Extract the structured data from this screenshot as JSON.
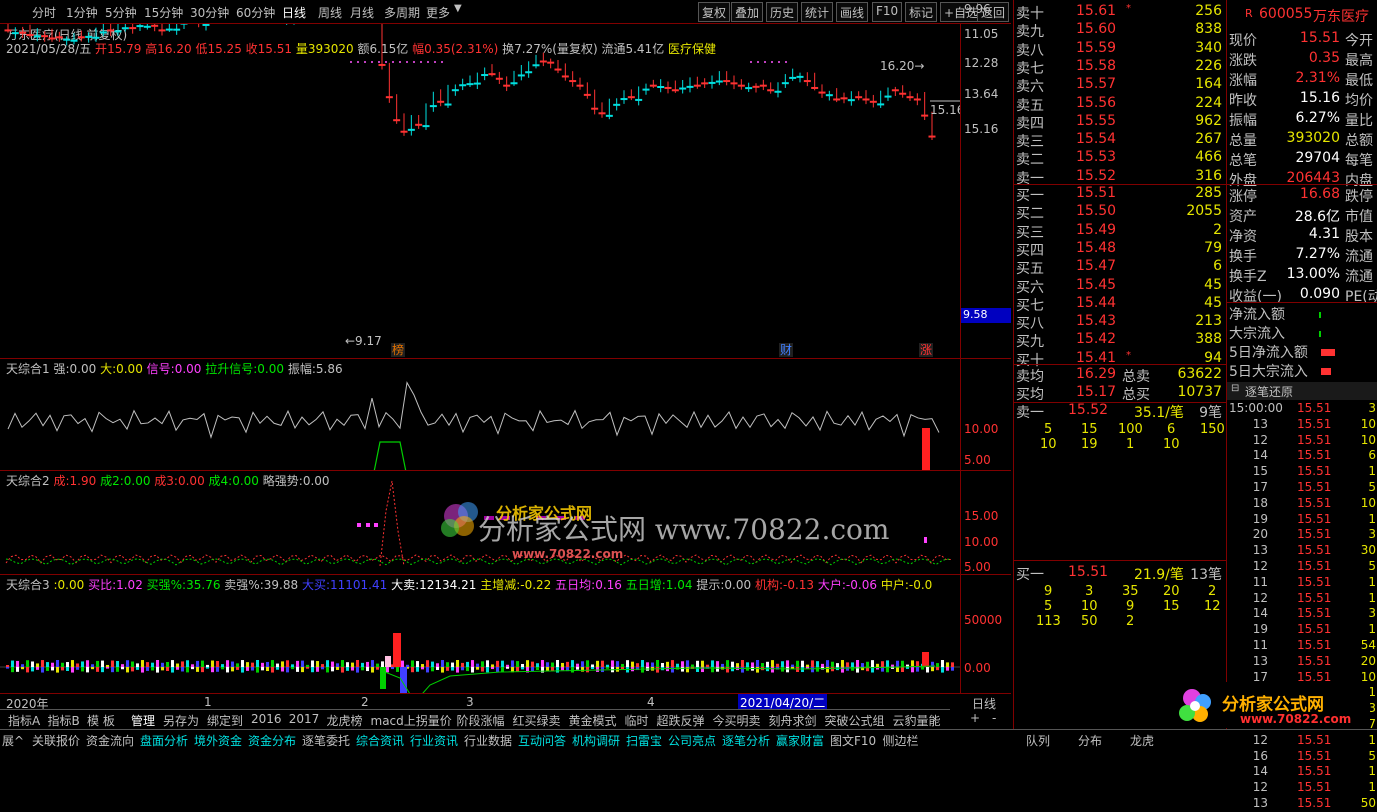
{
  "toolbar": {
    "periods": [
      "分时",
      "1分钟",
      "5分钟",
      "15分钟",
      "30分钟",
      "60分钟",
      "日线",
      "周线",
      "月线",
      "多周期",
      "更多"
    ],
    "active_period": "日线",
    "buttons": [
      "复权",
      "叠加",
      "历史",
      "统计",
      "画线",
      "F10",
      "标记",
      "+自选",
      "返回"
    ]
  },
  "stock": {
    "title": "万东医疗(日线 前复权)",
    "date": "2021/05/28/五",
    "open_label": "开",
    "open": "15.79",
    "high_label": "高",
    "high": "16.20",
    "low_label": "低",
    "low": "15.25",
    "close_label": "收",
    "close": "15.51",
    "vol_label": "量",
    "vol": "393020",
    "amt_label": "额",
    "amt": "6.15亿",
    "chg_label": "幅",
    "chg": "0.35(2.31%)",
    "turnover": "换7.27%(量复权)",
    "float": "流通5.41亿",
    "sector": "医疗保健"
  },
  "price_axis": [
    "15.16",
    "13.64",
    "12.28",
    "11.05",
    "9.96"
  ],
  "price_current": "9.58",
  "price_annotations": {
    "high": "16.20",
    "low": "9.17",
    "last": "15.16"
  },
  "markers": [
    "榜",
    "财",
    "涨"
  ],
  "ind1": {
    "name": "天综合1",
    "fields": [
      {
        "label": "强:",
        "value": "0.00",
        "color": "#c0c0c0"
      },
      {
        "label": "大:",
        "value": "0.00",
        "color": "#e6e600"
      },
      {
        "label": "信号:",
        "value": "0.00",
        "color": "#ff40ff"
      },
      {
        "label": "拉升信号:",
        "value": "0.00",
        "color": "#00e600"
      },
      {
        "label": "振幅:",
        "value": "5.86",
        "color": "#c0c0c0"
      }
    ],
    "axis": [
      "10.00",
      "5.00"
    ]
  },
  "ind2": {
    "name": "天综合2",
    "fields": [
      {
        "label": "成:",
        "value": "1.90",
        "color": "#ff3232"
      },
      {
        "label": "成2:",
        "value": "0.00",
        "color": "#00e600"
      },
      {
        "label": "成3:",
        "value": "0.00",
        "color": "#ff3232"
      },
      {
        "label": "成4:",
        "value": "0.00",
        "color": "#00e600"
      },
      {
        "label": "略强势:",
        "value": "0.00",
        "color": "#c0c0c0"
      }
    ],
    "axis": [
      "15.00",
      "10.00",
      "5.00"
    ],
    "watermark": "分析家公式网 www.70822.com",
    "watermark_small": "www.70822.com"
  },
  "ind3": {
    "name": "天综合3",
    "fields": [
      {
        "label": ":",
        "value": "0.00",
        "color": "#e6e600"
      },
      {
        "label": "买比:",
        "value": "1.02",
        "color": "#ff40ff"
      },
      {
        "label": "买强%:",
        "value": "35.76",
        "color": "#00e600"
      },
      {
        "label": "卖强%:",
        "value": "39.88",
        "color": "#c0c0c0"
      },
      {
        "label": "大买:",
        "value": "11101.41",
        "color": "#4040ff"
      },
      {
        "label": "大卖:",
        "value": "12134.21",
        "color": "#ffffff"
      },
      {
        "label": "主增减:",
        "value": "-0.22",
        "color": "#e6e600"
      },
      {
        "label": "五日均:",
        "value": "0.16",
        "color": "#ff40ff"
      },
      {
        "label": "五日增:",
        "value": "1.04",
        "color": "#00e600"
      },
      {
        "label": "提示:",
        "value": "0.00",
        "color": "#c0c0c0"
      },
      {
        "label": "机构:",
        "value": "-0.13",
        "color": "#ff3232"
      },
      {
        "label": "大户:",
        "value": "-0.06",
        "color": "#ff40ff"
      },
      {
        "label": "中户:",
        "value": "-0.0",
        "color": "#e6e600"
      }
    ],
    "axis": [
      "50000",
      "0.00"
    ]
  },
  "time_axis": {
    "year": "2020年",
    "m1": "1",
    "m2": "2",
    "m3": "3",
    "m4": "4",
    "cursor": "2021/04/20/二",
    "period": "日线"
  },
  "tabs1": [
    "指标A",
    "指标B",
    "模 板",
    "管理",
    "另存为",
    "绑定到",
    "2016",
    "2017",
    "龙虎榜",
    "macd上拐量价",
    "阶段涨幅",
    "红买绿卖",
    "黄金模式",
    "临时",
    "超跌反弹",
    "今买明卖",
    "刻舟求剑",
    "突破公式组",
    "云豹量能"
  ],
  "tabs1_active": "管理",
  "tabs2": [
    "展^",
    "关联报价",
    "资金流向",
    "盘面分析",
    "境外资金",
    "资金分布",
    "逐笔委托",
    "综合资讯",
    "行业资讯",
    "行业数据",
    "互动问答",
    "机构调研",
    "扫雷宝",
    "公司亮点",
    "逐笔分析",
    "赢家财富",
    "图文F10",
    "侧边栏"
  ],
  "tabs2_cyan": [
    "盘面分析",
    "境外资金",
    "资金分布",
    "综合资讯",
    "行业资讯",
    "互动问答",
    "机构调研",
    "扫雷宝",
    "公司亮点",
    "逐笔分析",
    "赢家财富"
  ],
  "right_tabs": [
    "队列",
    "分布",
    "龙虎"
  ],
  "orderbook": {
    "sells": [
      {
        "label": "卖十",
        "price": "15.61",
        "vol": "256",
        "flag": "*"
      },
      {
        "label": "卖九",
        "price": "15.60",
        "vol": "838",
        "flag": ""
      },
      {
        "label": "卖八",
        "price": "15.59",
        "vol": "340",
        "flag": ""
      },
      {
        "label": "卖七",
        "price": "15.58",
        "vol": "226",
        "flag": ""
      },
      {
        "label": "卖六",
        "price": "15.57",
        "vol": "164",
        "flag": ""
      },
      {
        "label": "卖五",
        "price": "15.56",
        "vol": "224",
        "flag": ""
      },
      {
        "label": "卖四",
        "price": "15.55",
        "vol": "962",
        "flag": ""
      },
      {
        "label": "卖三",
        "price": "15.54",
        "vol": "267",
        "flag": ""
      },
      {
        "label": "卖二",
        "price": "15.53",
        "vol": "466",
        "flag": ""
      },
      {
        "label": "卖一",
        "price": "15.52",
        "vol": "316",
        "flag": ""
      }
    ],
    "buys": [
      {
        "label": "买一",
        "price": "15.51",
        "vol": "285",
        "flag": ""
      },
      {
        "label": "买二",
        "price": "15.50",
        "vol": "2055",
        "flag": ""
      },
      {
        "label": "买三",
        "price": "15.49",
        "vol": "2",
        "flag": ""
      },
      {
        "label": "买四",
        "price": "15.48",
        "vol": "79",
        "flag": ""
      },
      {
        "label": "买五",
        "price": "15.47",
        "vol": "6",
        "flag": ""
      },
      {
        "label": "买六",
        "price": "15.45",
        "vol": "45",
        "flag": ""
      },
      {
        "label": "买七",
        "price": "15.44",
        "vol": "45",
        "flag": ""
      },
      {
        "label": "买八",
        "price": "15.43",
        "vol": "213",
        "flag": ""
      },
      {
        "label": "买九",
        "price": "15.42",
        "vol": "388",
        "flag": ""
      },
      {
        "label": "买十",
        "price": "15.41",
        "vol": "94",
        "flag": "*"
      }
    ],
    "avg_sell_label": "卖均",
    "avg_sell": "16.29",
    "total_sell_label": "总卖",
    "total_sell": "63622",
    "avg_buy_label": "买均",
    "avg_buy": "15.17",
    "total_buy_label": "总买",
    "total_buy": "10737",
    "sell1_queue": {
      "label": "卖一",
      "price": "15.52",
      "avg": "35.1/笔",
      "count": "9笔",
      "rows": [
        [
          "5",
          "15",
          "100",
          "6",
          "150"
        ],
        [
          "10",
          "19",
          "1",
          "10",
          ""
        ]
      ]
    },
    "buy1_queue": {
      "label": "买一",
      "price": "15.51",
      "avg": "21.9/笔",
      "count": "13笔",
      "rows": [
        [
          "9",
          "3",
          "35",
          "20",
          "2"
        ],
        [
          "5",
          "10",
          "9",
          "15",
          "12"
        ],
        [
          "113",
          "50",
          "2",
          "",
          ""
        ]
      ]
    }
  },
  "quote": {
    "code": "600055",
    "name": "万东医疗",
    "r": "R",
    "rows": [
      {
        "label": "现价",
        "value": "15.51",
        "extra": "今开",
        "color": "#ff3232"
      },
      {
        "label": "涨跌",
        "value": "0.35",
        "extra": "最高",
        "color": "#ff3232"
      },
      {
        "label": "涨幅",
        "value": "2.31%",
        "extra": "最低",
        "color": "#ff3232"
      },
      {
        "label": "昨收",
        "value": "15.16",
        "extra": "均价",
        "color": "#ffffff"
      },
      {
        "label": "振幅",
        "value": "6.27%",
        "extra": "量比",
        "color": "#ffffff"
      },
      {
        "label": "总量",
        "value": "393020",
        "extra": "总额",
        "color": "#e6e600"
      },
      {
        "label": "总笔",
        "value": "29704",
        "extra": "每笔",
        "color": "#ffffff"
      },
      {
        "label": "外盘",
        "value": "206443",
        "extra": "内盘",
        "color": "#ff3232"
      },
      {
        "label": "涨停",
        "value": "16.68",
        "extra": "跌停",
        "color": "#ff3232"
      },
      {
        "label": "资产",
        "value": "28.6亿",
        "extra": "市值",
        "color": "#ffffff"
      },
      {
        "label": "净资",
        "value": "4.31",
        "extra": "股本",
        "color": "#ffffff"
      },
      {
        "label": "换手",
        "value": "7.27%",
        "extra": "流通",
        "color": "#ffffff"
      },
      {
        "label": "换手Z",
        "value": "13.00%",
        "extra": "流通",
        "color": "#ffffff"
      },
      {
        "label": "收益(一)",
        "value": "0.090",
        "extra": "PE(动)",
        "color": "#ffffff"
      }
    ],
    "flows": [
      {
        "label": "净流入额"
      },
      {
        "label": "大宗流入"
      },
      {
        "label": "5日净流入额"
      },
      {
        "label": "5日大宗流入"
      }
    ],
    "ticks_title": "逐笔还原",
    "ticks": [
      {
        "t": "15:00:00",
        "p": "15.51",
        "v": "3"
      },
      {
        "t": "13",
        "p": "15.51",
        "v": "10"
      },
      {
        "t": "12",
        "p": "15.51",
        "v": "10"
      },
      {
        "t": "14",
        "p": "15.51",
        "v": "6"
      },
      {
        "t": "15",
        "p": "15.51",
        "v": "1"
      },
      {
        "t": "17",
        "p": "15.51",
        "v": "5"
      },
      {
        "t": "18",
        "p": "15.51",
        "v": "10"
      },
      {
        "t": "19",
        "p": "15.51",
        "v": "1"
      },
      {
        "t": "20",
        "p": "15.51",
        "v": "3"
      },
      {
        "t": "13",
        "p": "15.51",
        "v": "30"
      },
      {
        "t": "12",
        "p": "15.51",
        "v": "5"
      },
      {
        "t": "11",
        "p": "15.51",
        "v": "1"
      },
      {
        "t": "12",
        "p": "15.51",
        "v": "1"
      },
      {
        "t": "14",
        "p": "15.51",
        "v": "3"
      },
      {
        "t": "19",
        "p": "15.51",
        "v": "1"
      },
      {
        "t": "11",
        "p": "15.51",
        "v": "54"
      },
      {
        "t": "13",
        "p": "15.51",
        "v": "20"
      },
      {
        "t": "17",
        "p": "15.51",
        "v": "10"
      },
      {
        "t": "14",
        "p": "15.51",
        "v": "1"
      },
      {
        "t": "15",
        "p": "15.51",
        "v": "3"
      },
      {
        "t": "11",
        "p": "15.51",
        "v": "7"
      },
      {
        "t": "12",
        "p": "15.51",
        "v": "1"
      },
      {
        "t": "16",
        "p": "15.51",
        "v": "5"
      },
      {
        "t": "14",
        "p": "15.51",
        "v": "1"
      },
      {
        "t": "12",
        "p": "15.51",
        "v": "1"
      },
      {
        "t": "13",
        "p": "15.51",
        "v": "50"
      }
    ]
  },
  "logo": {
    "text": "分析家公式网",
    "url": "www.70822.com"
  },
  "colors": {
    "up": "#ff3232",
    "down": "#00e0e0",
    "grid": "#800000"
  }
}
